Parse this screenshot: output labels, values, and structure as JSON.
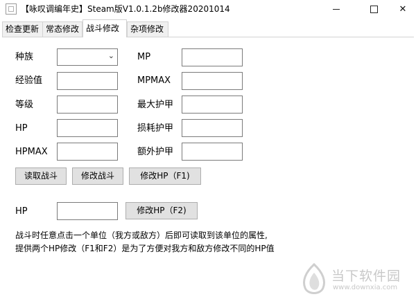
{
  "window": {
    "title": "【咏叹调编年史】Steam版V1.0.1.2b修改器20201014",
    "controls": {
      "minimize": "minimize-icon",
      "maximize": "maximize-icon",
      "close": "✕"
    }
  },
  "tabs": [
    {
      "label": "检查更新",
      "active": false
    },
    {
      "label": "常态修改",
      "active": false
    },
    {
      "label": "战斗修改",
      "active": true
    },
    {
      "label": "杂项修改",
      "active": false
    }
  ],
  "form": {
    "left": {
      "race_label": "种族",
      "race_value": "",
      "exp_label": "经验值",
      "exp_value": "",
      "level_label": "等级",
      "level_value": "",
      "hp_label": "HP",
      "hp_value": "",
      "hpmax_label": "HPMAX",
      "hpmax_value": ""
    },
    "right": {
      "mp_label": "MP",
      "mp_value": "",
      "mpmax_label": "MPMAX",
      "mpmax_value": "",
      "max_armor_label": "最大护甲",
      "max_armor_value": "",
      "lost_armor_label": "损耗护甲",
      "lost_armor_value": "",
      "extra_armor_label": "额外护甲",
      "extra_armor_value": ""
    },
    "buttons": {
      "read_battle": "读取战斗",
      "modify_battle": "修改战斗",
      "modify_hp_f1": "修改HP（F1)"
    },
    "hp2_label": "HP",
    "hp2_value": "",
    "modify_hp_f2": "修改HP（F2)"
  },
  "description": {
    "line1": "战斗时任意点击一个单位（我方或敌方）后即可读取到该单位的属性,",
    "line2": "提供两个HP修改（F1和F2）是为了方便对我方和敌方修改不同的HP值"
  },
  "watermark": {
    "name": "当下软件园",
    "url": "www.downxia.com"
  }
}
